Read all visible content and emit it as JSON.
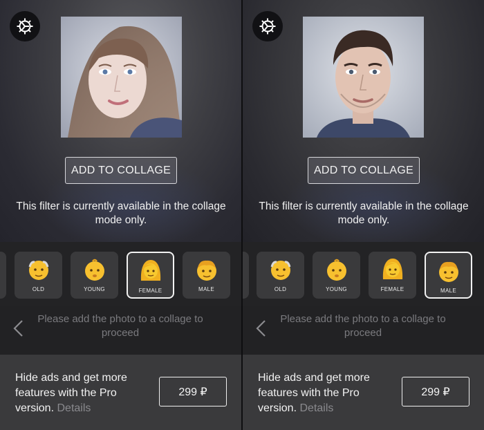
{
  "panels": [
    {
      "id": "left",
      "photo_subject": "female",
      "add_to_collage_label": "ADD TO COLLAGE",
      "notice": "This filter is currently available in the collage mode only.",
      "filters": [
        {
          "label": "OLD",
          "icon": "older-man-emoji-icon"
        },
        {
          "label": "YOUNG",
          "icon": "baby-emoji-icon"
        },
        {
          "label": "FEMALE",
          "icon": "woman-emoji-icon"
        },
        {
          "label": "MALE",
          "icon": "boy-emoji-icon"
        }
      ],
      "selected_filter": "FEMALE",
      "proceed_text": "Please add the photo to a collage to proceed",
      "promo_text": "Hide ads and get more features with the Pro version.",
      "promo_details": "Details",
      "price": "299 ₽"
    },
    {
      "id": "right",
      "photo_subject": "male",
      "add_to_collage_label": "ADD TO COLLAGE",
      "notice": "This filter is currently available in the collage mode only.",
      "filters": [
        {
          "label": "OLD",
          "icon": "older-man-emoji-icon"
        },
        {
          "label": "YOUNG",
          "icon": "baby-emoji-icon"
        },
        {
          "label": "FEMALE",
          "icon": "woman-emoji-icon"
        },
        {
          "label": "MALE",
          "icon": "boy-emoji-icon"
        }
      ],
      "selected_filter": "MALE",
      "proceed_text": "Please add the photo to a collage to proceed",
      "promo_text": "Hide ads and get more features with the Pro version.",
      "promo_details": "Details",
      "price": "299 ₽"
    }
  ],
  "icons": {
    "settings": "gear-icon",
    "back": "chevron-left-icon"
  },
  "colors": {
    "background": "#1c1c1e",
    "promo_background": "#3a3a3c",
    "filter_tile": "#3a3a3c",
    "emoji_yellow": "#f7c02f",
    "muted_text": "#7a7a7e",
    "details_text": "#8a8a8e"
  }
}
